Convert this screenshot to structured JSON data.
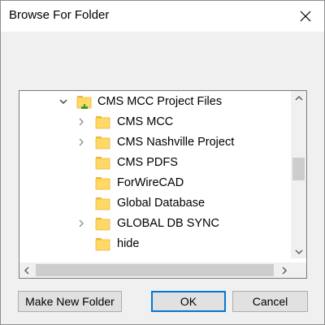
{
  "window": {
    "title": "Browse For Folder"
  },
  "tree": {
    "rows": [
      {
        "label": "CMS MCC Project Files",
        "expander": "expanded",
        "icon": "shared-folder-icon"
      },
      {
        "label": "CMS MCC",
        "expander": "collapsed",
        "icon": "folder-icon"
      },
      {
        "label": "CMS Nashville Project",
        "expander": "collapsed",
        "icon": "folder-icon"
      },
      {
        "label": "CMS PDFS",
        "expander": "none",
        "icon": "folder-icon"
      },
      {
        "label": "ForWireCAD",
        "expander": "none",
        "icon": "folder-icon"
      },
      {
        "label": "Global Database",
        "expander": "none",
        "icon": "folder-icon"
      },
      {
        "label": "GLOBAL DB SYNC",
        "expander": "collapsed",
        "icon": "folder-icon"
      },
      {
        "label": "hide",
        "expander": "none",
        "icon": "folder-icon"
      }
    ]
  },
  "buttons": {
    "make_new_folder": "Make New Folder",
    "ok": "OK",
    "cancel": "Cancel"
  },
  "colors": {
    "folder": "#ffd866",
    "folder_dark": "#e8b839",
    "accent": "#0078d7",
    "share_green": "#3a9f2a"
  }
}
